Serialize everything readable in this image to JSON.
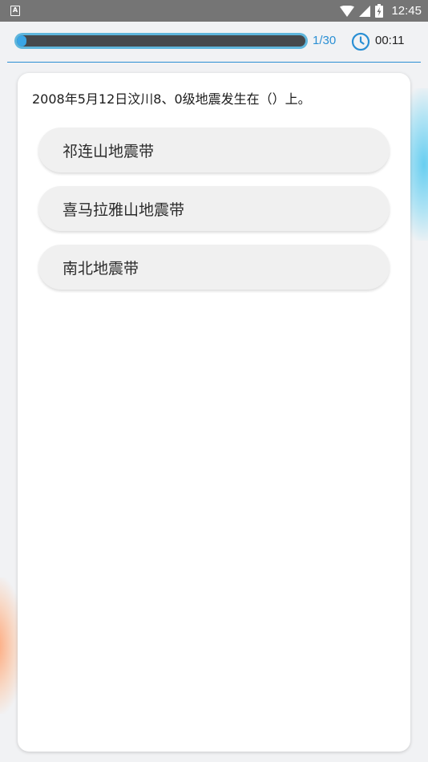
{
  "status_bar": {
    "app_icon_letter": "A",
    "time": "12:45",
    "icons": [
      "wifi-icon",
      "cellular-signal-icon",
      "battery-charging-icon"
    ]
  },
  "header": {
    "progress": {
      "current": 1,
      "total": 30,
      "label": "1/30",
      "fraction": 0.033
    },
    "timer": {
      "icon": "clock-icon",
      "value": "00:11"
    }
  },
  "quiz": {
    "question": "2008年5月12日汶川8、0级地震发生在（）上。",
    "options": [
      {
        "label": "祁连山地震带"
      },
      {
        "label": "喜马拉雅山地震带"
      },
      {
        "label": "南北地震带"
      }
    ]
  },
  "colors": {
    "status_bar_bg": "#757575",
    "accent_blue": "#2a8fd4",
    "progress_border": "#5fb6dc",
    "progress_track": "#46494c",
    "option_bg": "#f0f0f0",
    "page_bg": "#f1f2f4"
  }
}
